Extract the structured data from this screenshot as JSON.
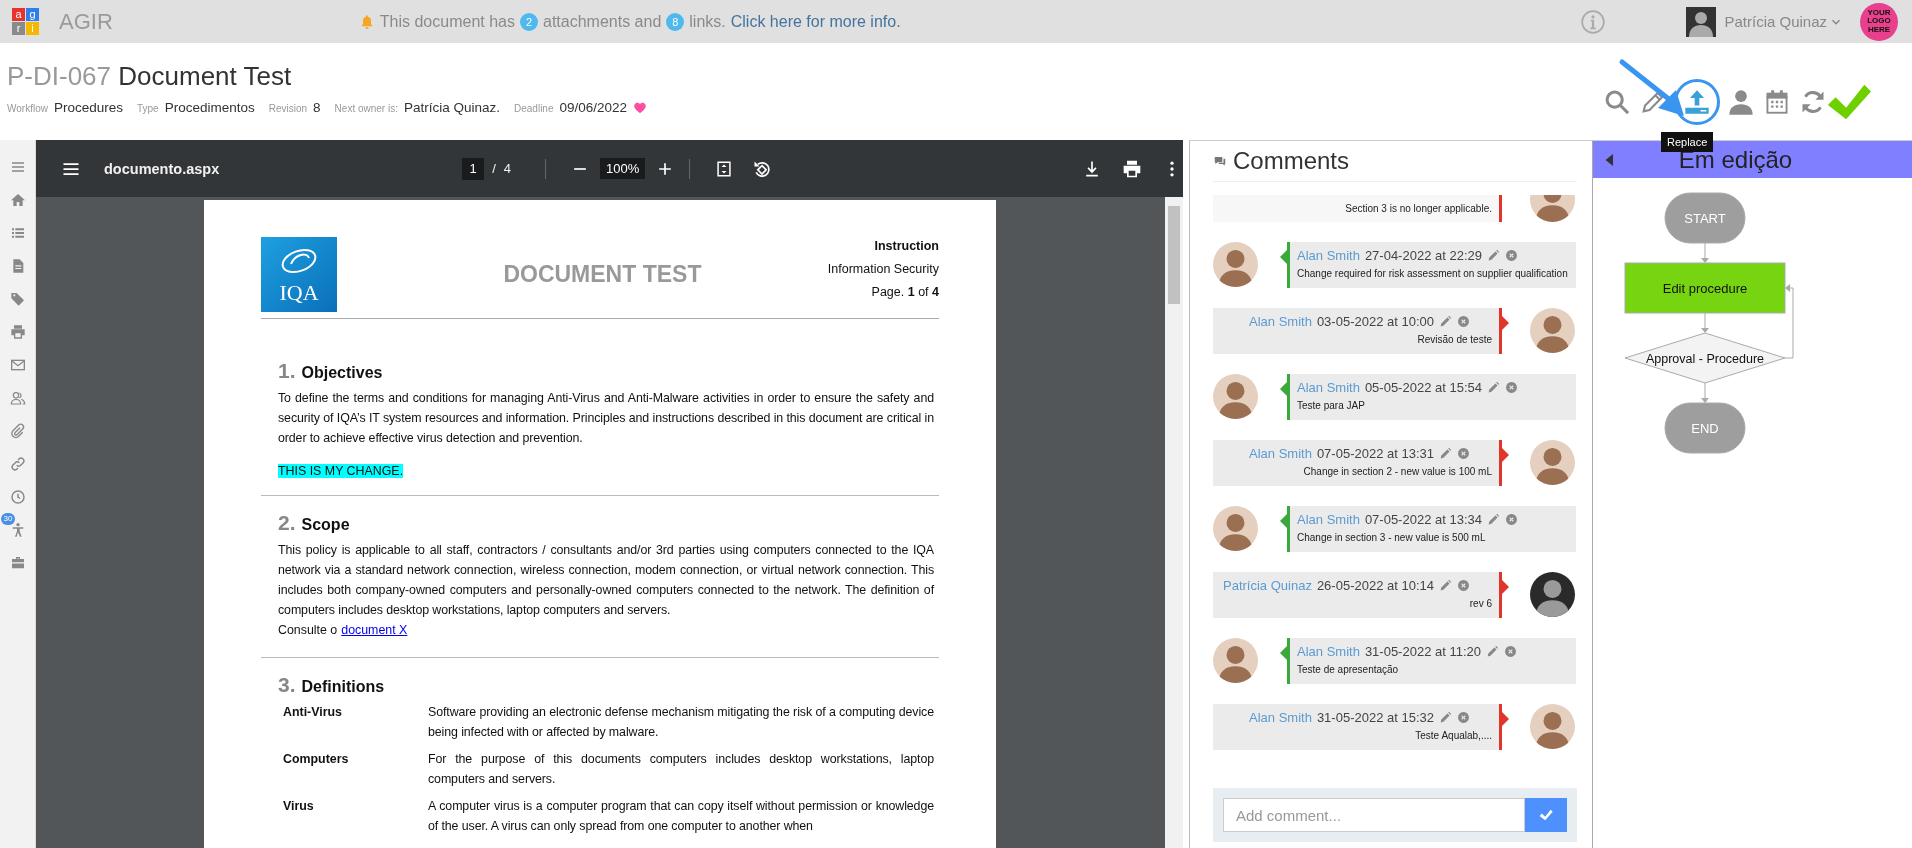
{
  "topbar": {
    "logo_letters": [
      {
        "letter": "a",
        "color": "#e8322f"
      },
      {
        "letter": "g",
        "color": "#2f7fe8"
      },
      {
        "letter": "r",
        "color": "#8a8a8a"
      },
      {
        "letter": "i",
        "color": "#f5b800"
      }
    ],
    "app_name": "AGIR",
    "notice": {
      "prefix": "This document has",
      "attachments_count": "2",
      "attachments_label": "attachments and",
      "links_count": "8",
      "links_label": "links.",
      "link": "Click here for more info."
    },
    "user": {
      "name": "Patrícia Quinaz"
    },
    "brand_logo": "YOUR LOGO HERE"
  },
  "document": {
    "code": "P-DI-067",
    "title": "Document Test",
    "meta": [
      {
        "label": "Workflow",
        "value": "Procedures"
      },
      {
        "label": "Type",
        "value": "Procedimentos"
      },
      {
        "label": "Revision",
        "value": "8"
      },
      {
        "label": "Next owner is:",
        "value": "Patrícia Quinaz."
      },
      {
        "label": "Deadline",
        "value": "09/06/2022"
      }
    ],
    "favorite": true
  },
  "toolbar": {
    "actions": [
      {
        "kind": "search",
        "highlighted": false
      },
      {
        "kind": "edit",
        "highlighted": false
      },
      {
        "kind": "replace",
        "highlighted": true
      },
      {
        "kind": "owner",
        "highlighted": false
      },
      {
        "kind": "calendar",
        "highlighted": false
      },
      {
        "kind": "refresh",
        "highlighted": false
      },
      {
        "kind": "approve",
        "highlighted": false
      }
    ],
    "tooltip": "Replace"
  },
  "sidebar": {
    "items": [
      {
        "kind": "menu"
      },
      {
        "kind": "home"
      },
      {
        "kind": "list"
      },
      {
        "kind": "document"
      },
      {
        "kind": "tags"
      },
      {
        "kind": "print"
      },
      {
        "kind": "mail"
      },
      {
        "kind": "users"
      },
      {
        "kind": "attachments"
      },
      {
        "kind": "links"
      },
      {
        "kind": "history"
      },
      {
        "kind": "accessibility",
        "badge": "30"
      },
      {
        "kind": "archive"
      }
    ]
  },
  "viewer": {
    "file_name": "documento.aspx",
    "page": "1",
    "separator": "/",
    "page_count": "4",
    "zoom": "100%"
  },
  "page": {
    "logo_text": "IQA",
    "heading": "DOCUMENT TEST",
    "doc_type": "Instruction",
    "category": "Information Security",
    "page_label": "Page. **1** of **4**",
    "sections": [
      {
        "number": "1.",
        "title": "Objectives",
        "blocks": [
          {
            "kind": "paragraph",
            "text": "To define the terms and conditions for managing Anti-Virus and Anti-Malware activities in order to ensure the safety and security of IQA’s IT system resources and information. Principles and instructions described in this document are critical in order to achieve effective virus detection and prevention."
          },
          {
            "kind": "highlight",
            "text": "THIS IS MY CHANGE."
          }
        ]
      },
      {
        "number": "2.",
        "title": "Scope",
        "blocks": [
          {
            "kind": "paragraph",
            "text": "This policy is applicable to all staff, contractors / consultants and/or 3rd parties using computers connected to the IQA network via a standard network connection, wireless connection, modem connection, or virtual network connection. This includes both company-owned computers and personally-owned computers connected to the network. The definition of computers includes desktop workstations, laptop computers and servers."
          },
          {
            "kind": "link_line",
            "text": "Consulte o",
            "link": "document X"
          }
        ]
      },
      {
        "number": "3.",
        "title": "Definitions",
        "blocks": [
          {
            "kind": "definitions",
            "items": [
              {
                "term": "Anti-Virus",
                "definition": "Software providing an electronic defense mechanism mitigating the risk of a computing device being infected with or affected by malware."
              },
              {
                "term": "Computers",
                "definition": "For the purpose of this documents computers includes desktop workstations, laptop computers and servers."
              },
              {
                "term": "Virus",
                "definition": "A computer virus is a computer program that can copy itself without permission or knowledge of the user. A virus can only spread from one computer to another when"
              }
            ]
          }
        ]
      }
    ]
  },
  "comments": {
    "title": "Comments",
    "items": [
      {
        "kind": "right",
        "cut": true,
        "avatar": {
          "kind": "light"
        },
        "text": "Section 3 is no longer applicable."
      },
      {
        "kind": "left",
        "cut": false,
        "avatar": {
          "kind": "light"
        },
        "author": "Alan Smith",
        "date": "27-04-2022 at 22:29",
        "text": "Change required for risk assessment on supplier qualification"
      },
      {
        "kind": "right",
        "cut": false,
        "avatar": {
          "kind": "light"
        },
        "author": "Alan Smith",
        "date": "03-05-2022 at 10:00",
        "text": "Revisão de teste"
      },
      {
        "kind": "left",
        "cut": false,
        "avatar": {
          "kind": "light"
        },
        "author": "Alan Smith",
        "date": "05-05-2022 at 15:54",
        "text": "Teste para JAP"
      },
      {
        "kind": "right",
        "cut": false,
        "avatar": {
          "kind": "light"
        },
        "author": "Alan Smith",
        "date": "07-05-2022 at 13:31",
        "text": "Change in section 2 - new value is 100 mL"
      },
      {
        "kind": "left",
        "cut": false,
        "avatar": {
          "kind": "light"
        },
        "author": "Alan Smith",
        "date": "07-05-2022 at 13:34",
        "text": "Change in section 3 - new value is 500 mL"
      },
      {
        "kind": "right",
        "cut": false,
        "avatar": {
          "kind": "dark"
        },
        "author": "Patrícia Quinaz",
        "date": "26-05-2022 at 10:14",
        "text": "rev 6"
      },
      {
        "kind": "left",
        "cut": false,
        "avatar": {
          "kind": "light"
        },
        "author": "Alan Smith",
        "date": "31-05-2022 at 11:20",
        "text": "Teste de apresentação"
      },
      {
        "kind": "right",
        "cut": false,
        "avatar": {
          "kind": "light"
        },
        "author": "Alan Smith",
        "date": "31-05-2022 at 15:32",
        "text": "Teste Aqualab,...."
      }
    ],
    "input": {
      "placeholder": "Add comment..."
    }
  },
  "workflow": {
    "status": "Em edição",
    "nodes": [
      {
        "kind": "terminal",
        "label": "START",
        "current": false
      },
      {
        "kind": "task",
        "label": "Edit procedure",
        "current": true
      },
      {
        "kind": "decision",
        "label": "Approval - Procedure",
        "current": false
      },
      {
        "kind": "terminal",
        "label": "END",
        "current": false
      }
    ]
  }
}
